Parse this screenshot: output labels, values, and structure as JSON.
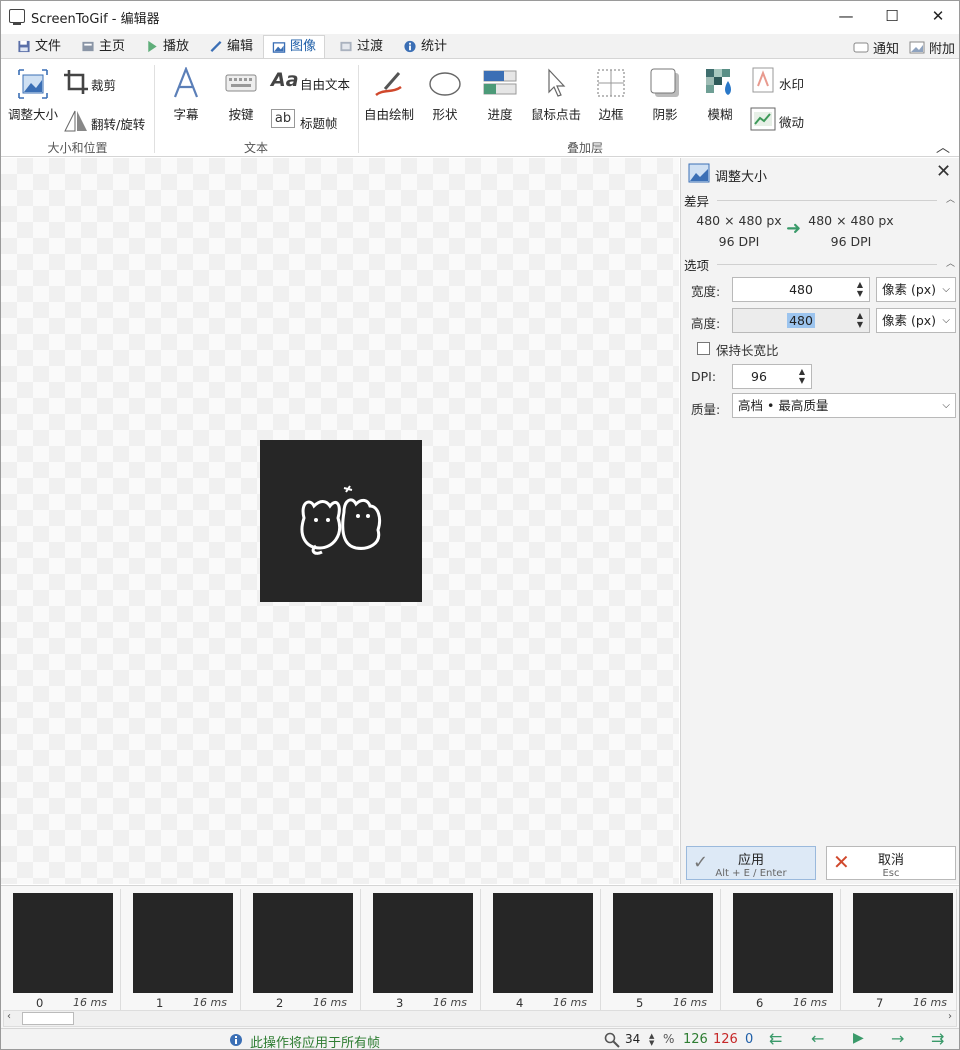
{
  "window": {
    "title": "ScreenToGif - 编辑器"
  },
  "tabs": [
    {
      "label": "文件"
    },
    {
      "label": "主页"
    },
    {
      "label": "播放"
    },
    {
      "label": "编辑"
    },
    {
      "label": "图像"
    },
    {
      "label": "过渡"
    },
    {
      "label": "统计"
    }
  ],
  "tab_right": {
    "notify": "通知",
    "extras": "附加"
  },
  "ribbon": {
    "resize": "调整大小",
    "crop": "裁剪",
    "flip_rotate": "翻转/旋转",
    "group_size": "大小和位置",
    "caption": "字幕",
    "key_strokes": "按键",
    "free_text": "自由文本",
    "title_frame": "标题帧",
    "group_text": "文本",
    "free_drawing": "自由绘制",
    "shapes": "形状",
    "progress": "进度",
    "mouse_clicks": "鼠标点击",
    "border": "边框",
    "shadow": "阴影",
    "obfuscate": "模糊",
    "watermark": "水印",
    "cinemagraph": "微动",
    "group_overlay": "叠加层"
  },
  "panel": {
    "title": "调整大小",
    "diff_label": "差异",
    "current_size": "480  ×  480 px",
    "current_dpi": "96 DPI",
    "new_size": "480  ×  480 px",
    "new_dpi": "96 DPI",
    "options_label": "选项",
    "width_label": "宽度:",
    "width_value": "480",
    "width_unit": "像素 (px)",
    "height_label": "高度:",
    "height_value": "480",
    "height_unit": "像素 (px)",
    "keep_aspect": "保持长宽比",
    "keep_aspect_checked": false,
    "dpi_label": "DPI:",
    "dpi_value": "96",
    "quality_label": "质量:",
    "quality_value": "高档 • 最高质量",
    "apply_label": "应用",
    "apply_shortcut": "Alt + E / Enter",
    "cancel_label": "取消",
    "cancel_shortcut": "Esc"
  },
  "frames": [
    {
      "index": "0",
      "delay": "16 ms"
    },
    {
      "index": "1",
      "delay": "16 ms"
    },
    {
      "index": "2",
      "delay": "16 ms"
    },
    {
      "index": "3",
      "delay": "16 ms"
    },
    {
      "index": "4",
      "delay": "16 ms"
    },
    {
      "index": "5",
      "delay": "16 ms"
    },
    {
      "index": "6",
      "delay": "16 ms"
    },
    {
      "index": "7",
      "delay": "16 ms"
    }
  ],
  "status": {
    "message": "此操作将应用于所有帧",
    "zoom": "34",
    "zoom_unit": "%",
    "total_frames": "126",
    "selected_frames": "126",
    "current_frame": "0"
  },
  "colors": {
    "accent": "#1f5fa8",
    "status_green": "#2e7d32",
    "status_red": "#c62828",
    "nav_green": "#3a9a6a"
  }
}
